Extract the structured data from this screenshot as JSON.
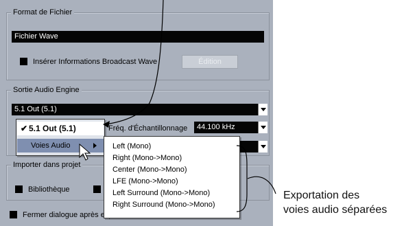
{
  "format_group": {
    "title": "Format de Fichier",
    "file_type": "Fichier Wave",
    "broadcast_label": "Insérer Informations Broadcast Wave",
    "edit_button": "Édition"
  },
  "output_group": {
    "title": "Sortie Audio Engine",
    "output_value": "5.1 Out (5.1)",
    "sample_rate_label": "Fréq. d'Échantillonnage",
    "sample_rate_value": "44.100 kHz"
  },
  "output_menu": {
    "checked_item": "5.1 Out (5.1)",
    "checkmark": "✔",
    "submenu_item": "Voies Audio"
  },
  "channels_submenu": {
    "items": [
      "Left (Mono)",
      "Right (Mono->Mono)",
      "Center (Mono->Mono)",
      "LFE (Mono->Mono)",
      "Left Surround (Mono->Mono)",
      "Right Surround (Mono->Mono)"
    ]
  },
  "import_group": {
    "title": "Importer dans projet",
    "library_label": "Bibliothèque"
  },
  "close_dialog_label": "Fermer dialogue après expor",
  "annotation": {
    "line1": "Exportation des",
    "line2": "voies audio séparées"
  }
}
